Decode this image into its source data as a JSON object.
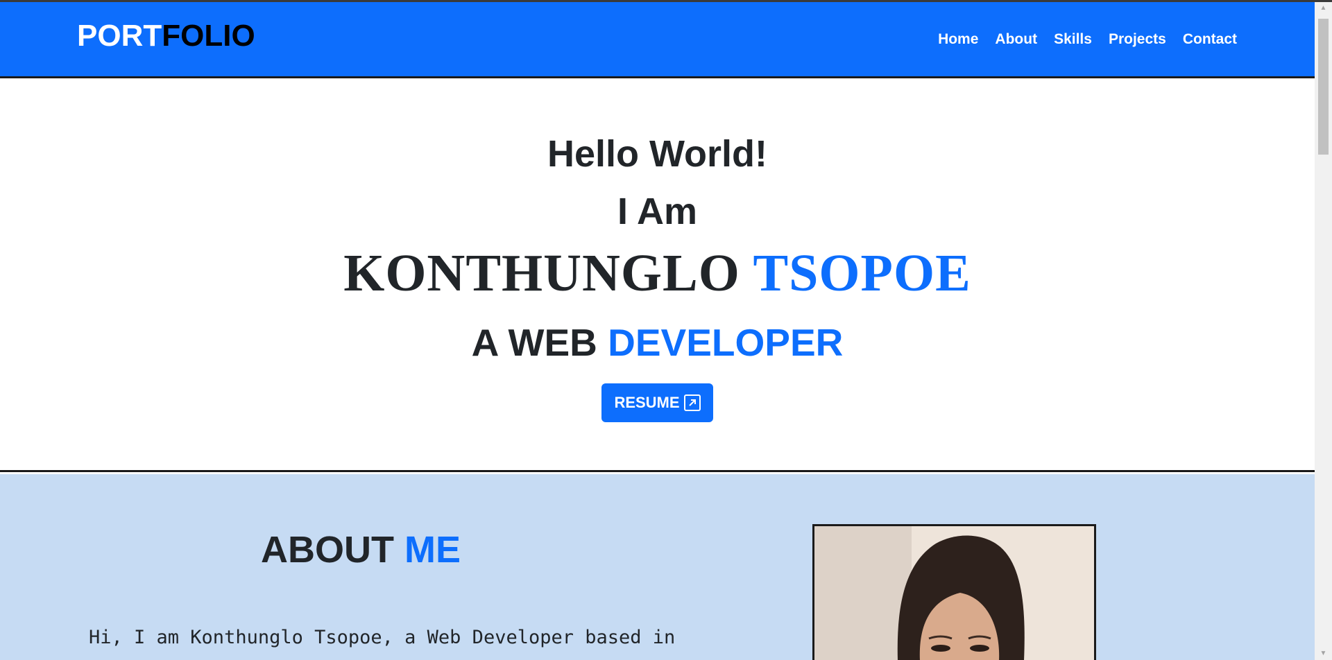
{
  "navbar": {
    "brand_part1": "PORT",
    "brand_part2": "FOLIO",
    "links": [
      "Home",
      "About",
      "Skills",
      "Projects",
      "Contact"
    ]
  },
  "hero": {
    "greeting": "Hello World!",
    "intro": "I Am",
    "first_name": "KONTHUNGLO",
    "last_name": "TSOPOE",
    "role_prefix": "A WEB",
    "role_highlight": "DEVELOPER",
    "resume_label": "RESUME",
    "resume_icon": "external-link-icon"
  },
  "about": {
    "title_main": "ABOUT",
    "title_highlight": "ME",
    "text": "Hi, I am Konthunglo Tsopoe, a Web Developer based in"
  },
  "scrollbar": {
    "up_icon": "triangle-up-icon",
    "down_icon": "triangle-down-icon"
  },
  "colors": {
    "primary": "#0d6efd",
    "about_bg": "#c6dbf3",
    "text": "#212529"
  }
}
